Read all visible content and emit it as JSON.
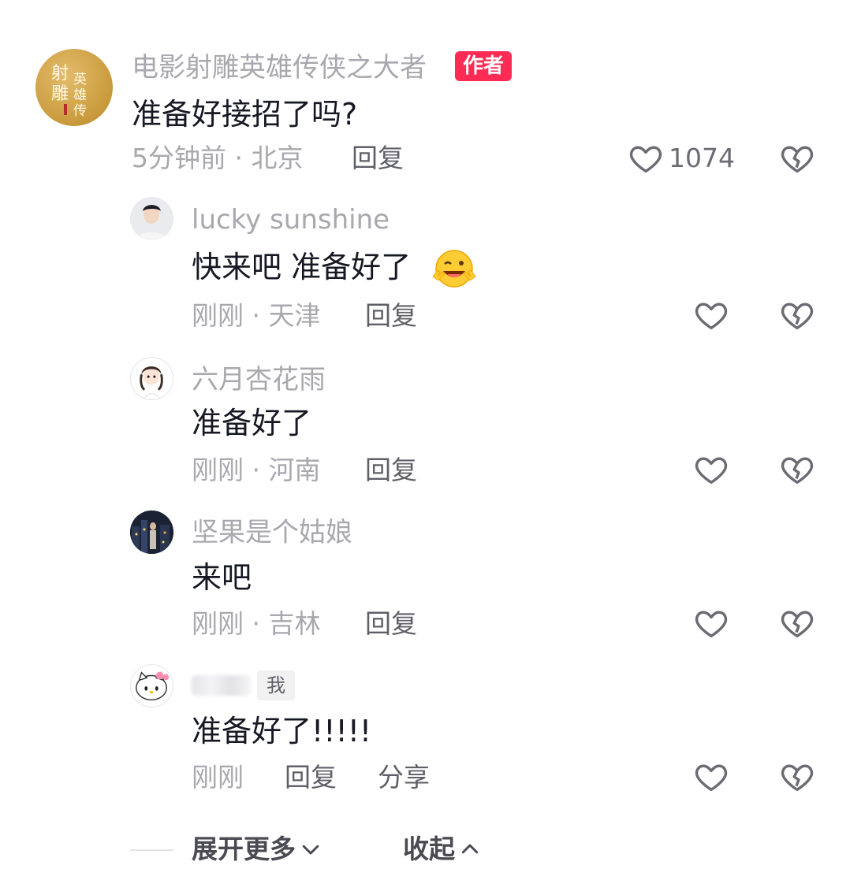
{
  "main_comment": {
    "author": "电影射雕英雄传侠之大者",
    "author_badge": "作者",
    "avatar_text": "射雕英雄传",
    "text": "准备好接招了吗?",
    "time": "5分钟前 · 北京",
    "reply_label": "回复",
    "like_count": "1074"
  },
  "replies": [
    {
      "author": "lucky sunshine",
      "text": "快来吧 准备好了",
      "meta": "刚刚 · 天津",
      "reply_label": "回复",
      "emoji": "winking-face-emoji"
    },
    {
      "author": "六月杏花雨",
      "text": "准备好了",
      "meta": "刚刚 · 河南",
      "reply_label": "回复"
    },
    {
      "author": "坚果是个姑娘",
      "text": "来吧",
      "meta": "刚刚 · 吉林",
      "reply_label": "回复"
    },
    {
      "author": "",
      "author_badge": "我",
      "text": "准备好了!!!!!",
      "meta": "刚刚",
      "reply_label": "回复",
      "share_label": "分享"
    }
  ],
  "footer": {
    "expand_label": "展开更多",
    "collapse_label": "收起"
  },
  "colors": {
    "accent": "#fe2c55",
    "text": "#161823",
    "muted": "#a8a8ae",
    "icon": "#6b6b73"
  }
}
